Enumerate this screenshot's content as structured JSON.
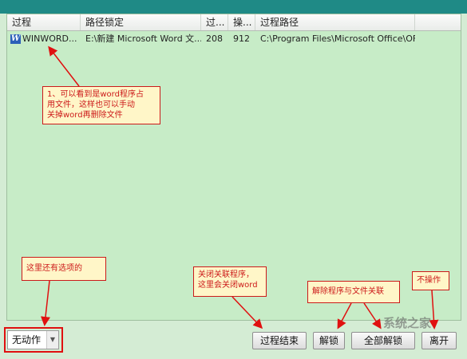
{
  "columns": [
    "过程",
    "路径锁定",
    "过...",
    "操...",
    "过程路径"
  ],
  "rows": [
    {
      "icon": "W",
      "name": "WINWORD...",
      "path": "E:\\新建 Microsoft Word 文...",
      "v1": "208",
      "v2": "912",
      "fullpath": "C:\\Program Files\\Microsoft Office\\OF..."
    }
  ],
  "notes": {
    "word": [
      "1、可以看到是word程序占",
      "用文件，这样也可以手动",
      "关掉word再删除文件"
    ],
    "options": "这里还有选项的",
    "close": [
      "关闭关联程序，",
      "这里会关闭word"
    ],
    "unlock": "解除程序与文件关联",
    "noop": "不操作"
  },
  "select": {
    "value": "无动作"
  },
  "buttons": {
    "end": "过程结束",
    "unlock": "解锁",
    "unlock_all": "全部解锁",
    "leave": "离开"
  },
  "watermark": "系统之家",
  "colors": {
    "background": "#c7ecc7",
    "annotation": "#cc1a1a"
  }
}
